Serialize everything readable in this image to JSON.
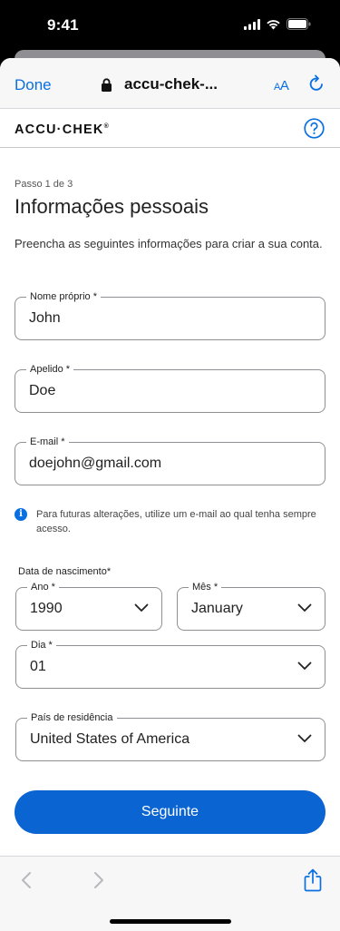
{
  "status": {
    "time": "9:41"
  },
  "browser": {
    "done_label": "Done",
    "url": "accu-chek-..."
  },
  "brand": {
    "logo": "ACCU·CHEK",
    "logo_mark": "®"
  },
  "form": {
    "step": "Passo 1 de 3",
    "title": "Informações pessoais",
    "intro": "Preencha as seguintes informações para criar a sua conta.",
    "first_name": {
      "label": "Nome próprio *",
      "value": "John"
    },
    "last_name": {
      "label": "Apelido *",
      "value": "Doe"
    },
    "email": {
      "label": "E-mail *",
      "value": "doejohn@gmail.com"
    },
    "email_hint": "Para futuras alterações, utilize um e-mail ao qual tenha sempre acesso.",
    "dob_label": "Data de nascimento*",
    "year": {
      "label": "Ano *",
      "value": "1990"
    },
    "month": {
      "label": "Mês *",
      "value": "January"
    },
    "day": {
      "label": "Dia *",
      "value": "01"
    },
    "country": {
      "label": "País de residência",
      "value": "United States of America"
    },
    "next_label": "Seguinte"
  },
  "colors": {
    "accent": "#0a6fe0",
    "button": "#0a64d2"
  }
}
